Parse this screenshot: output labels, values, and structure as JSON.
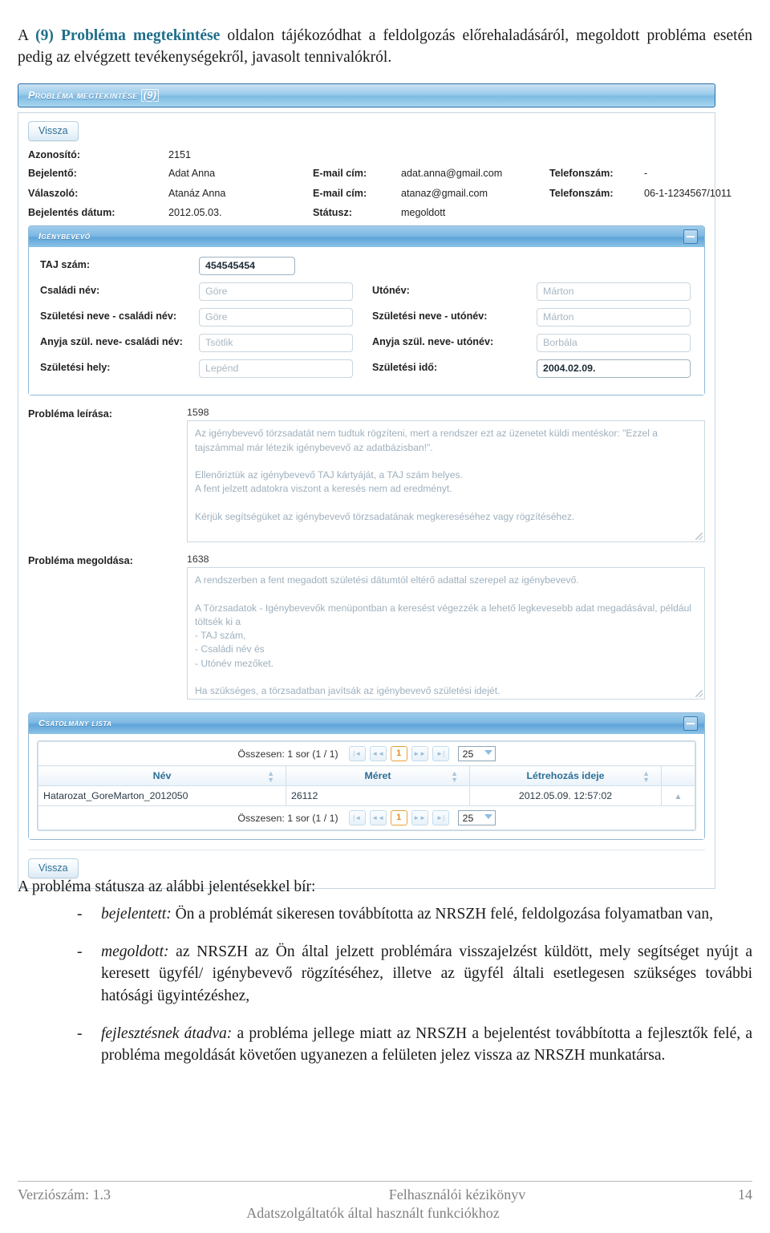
{
  "intro": {
    "before": "A ",
    "highlight": "(9) Probléma megtekintése",
    "after": " oldalon tájékozódhat a feldolgozás előrehaladásáról, megoldott probléma esetén pedig az elvégzett tevékenységekről, javasolt tennivalókról."
  },
  "screenshot": {
    "page_title": "Probléma megtekintése",
    "page_count": "(9)",
    "back_button_top": "Vissza",
    "back_button_bottom": "Vissza",
    "meta": {
      "id_label": "Azonosító:",
      "id_value": "2151",
      "reporter_label": "Bejelentő:",
      "reporter_value": "Adat Anna",
      "reporter_email_label": "E-mail cím:",
      "reporter_email_value": "adat.anna@gmail.com",
      "reporter_phone_label": "Telefonszám:",
      "reporter_phone_value": "-",
      "responder_label": "Válaszoló:",
      "responder_value": "Atanáz Anna",
      "responder_email_label": "E-mail cím:",
      "responder_email_value": "atanaz@gmail.com",
      "responder_phone_label": "Telefonszám:",
      "responder_phone_value": "06-1-1234567/1011",
      "date_label": "Bejelentés dátum:",
      "date_value": "2012.05.03.",
      "status_label": "Státusz:",
      "status_value": "megoldott"
    },
    "client_panel": {
      "title": "Igénybevevő",
      "collapse_icon": "minus-icon",
      "fields": {
        "taj_label": "TAJ szám:",
        "taj_value": "454545454",
        "family_name_label": "Családi név:",
        "family_name_value": "Göre",
        "given_name_label": "Utónév:",
        "given_name_value": "Márton",
        "birth_family_label": "Születési neve - családi név:",
        "birth_family_value": "Göre",
        "birth_given_label": "Születési neve - utónév:",
        "birth_given_value": "Márton",
        "mother_family_label": "Anyja szül. neve- családi név:",
        "mother_family_value": "Tsötlik",
        "mother_given_label": "Anyja szül. neve- utónév:",
        "mother_given_value": "Borbála",
        "birth_place_label": "Születési hely:",
        "birth_place_value": "Lepénd",
        "birth_date_label": "Születési idő:",
        "birth_date_value": "2004.02.09."
      }
    },
    "description": {
      "label": "Probléma leírása:",
      "counter": "1598",
      "text": "Az igénybevevő törzsadatát nem tudtuk rögzíteni, mert a rendszer ezt az üzenetet küldi mentéskor: \"Ezzel a tajszámmal már létezik igénybevevő az adatbázisban!\".\n\nEllenőriztük az igénybevevő TAJ kártyáját, a TAJ szám helyes.\nA fent jelzett adatokra viszont a keresés nem ad eredményt.\n\nKérjük segítségüket az igénybevevő törzsadatának megkereséséhez vagy rögzítéséhez."
    },
    "solution": {
      "label": "Probléma megoldása:",
      "counter": "1638",
      "text": "A rendszerben a fent megadott születési dátumtól eltérő adattal szerepel az igénybevevő.\n\nA Törzsadatok - Igénybevevők menüpontban a keresést végezzék a lehető legkevesebb adat megadásával, például töltsék ki a\n- TAJ szám,\n- Családi név és\n- Utónév mezőket.\n\nHa szükséges, a törzsadatban javítsák az igénybevevő születési idejét."
    },
    "attachments": {
      "title": "Csatolmány lista",
      "collapse_icon": "minus-icon",
      "pager_text": "Összesen: 1 sor (1 / 1)",
      "page_size": "25",
      "nav": {
        "first": "first-page-icon",
        "prev": "prev-page-icon",
        "current": "1",
        "next": "next-page-icon",
        "last": "last-page-icon"
      },
      "columns": [
        "Név",
        "Méret",
        "Létrehozás ideje"
      ],
      "rows": [
        {
          "name": "Hatarozat_GoreMarton_2012050",
          "size": "26112",
          "created": "2012.05.09. 12:57:02",
          "action_icon": "caret-up-icon"
        }
      ]
    }
  },
  "body": {
    "lead": "A probléma státusza az alábbi jelentésekkel bír:",
    "bullets": [
      {
        "dash": "-",
        "term": "bejelentett:",
        "text": " Ön a problémát sikeresen továbbította az NRSZH felé, feldolgozása folyamatban van,"
      },
      {
        "dash": "-",
        "term": "megoldott:",
        "text": " az NRSZH az Ön által jelzett problémára visszajelzést küldött, mely segítséget nyújt a keresett ügyfél/ igénybevevő rögzítéséhez, illetve az ügyfél általi esetlegesen szükséges további hatósági ügyintézéshez,"
      },
      {
        "dash": "-",
        "term": "fejlesztésnek átadva:",
        "text": " a probléma jellege miatt az NRSZH a bejelentést továbbította a fejlesztők felé, a probléma megoldását követően ugyanezen a felületen jelez vissza az NRSZH munkatársa."
      }
    ]
  },
  "footer": {
    "version": "Verziószám: 1.3",
    "doc_title": "Felhasználói kézikönyv",
    "doc_subtitle": "Adatszolgáltatók által használt funkciókhoz",
    "page_number": "14"
  }
}
